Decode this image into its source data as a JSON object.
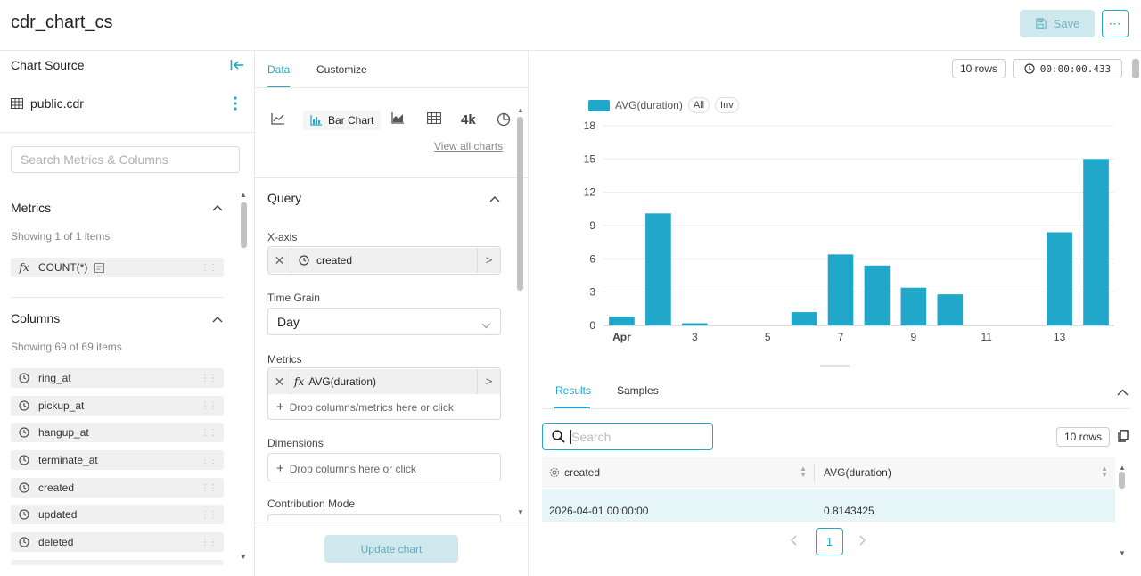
{
  "header": {
    "title": "cdr_chart_cs",
    "save_label": "Save",
    "more_label": "⋯"
  },
  "left_panel": {
    "title": "Chart Source",
    "dataset_name": "public.cdr",
    "search_placeholder": "Search Metrics & Columns",
    "metrics": {
      "title": "Metrics",
      "showing": "Showing 1 of 1 items",
      "items": [
        {
          "label": "COUNT(*)",
          "icon": "fx-icon"
        }
      ]
    },
    "columns": {
      "title": "Columns",
      "showing": "Showing 69 of 69 items",
      "items": [
        {
          "label": "ring_at",
          "icon": "clock-icon"
        },
        {
          "label": "pickup_at",
          "icon": "clock-icon"
        },
        {
          "label": "hangup_at",
          "icon": "clock-icon"
        },
        {
          "label": "terminate_at",
          "icon": "clock-icon"
        },
        {
          "label": "created",
          "icon": "clock-icon"
        },
        {
          "label": "updated",
          "icon": "clock-icon"
        },
        {
          "label": "deleted",
          "icon": "clock-icon"
        }
      ]
    }
  },
  "middle_panel": {
    "tabs": [
      {
        "label": "Data",
        "active": true
      },
      {
        "label": "Customize",
        "active": false
      }
    ],
    "viz_types": {
      "selected": "Bar Chart",
      "big_number_label": "4k",
      "view_all": "View all charts"
    },
    "query": {
      "title": "Query",
      "xaxis_label": "X-axis",
      "xaxis_value": "created",
      "time_grain_label": "Time Grain",
      "time_grain_value": "Day",
      "metrics_label": "Metrics",
      "metrics_value": "AVG(duration)",
      "metrics_drop": "Drop columns/metrics here or click",
      "dimensions_label": "Dimensions",
      "dimensions_drop": "Drop columns here or click",
      "contribution_label": "Contribution Mode"
    },
    "update_label": "Update chart"
  },
  "right_panel": {
    "rows_chip": "10 rows",
    "timer": "00:00:00.433",
    "legend": {
      "series": "AVG(duration)",
      "all": "All",
      "inv": "Inv"
    },
    "results_tabs": [
      {
        "label": "Results",
        "active": true
      },
      {
        "label": "Samples",
        "active": false
      }
    ],
    "search_placeholder": "Search",
    "table_rows_chip": "10 rows",
    "columns": [
      "created",
      "AVG(duration)"
    ],
    "rows": [
      [
        "2026-04-01 00:00:00",
        "0.8143425"
      ]
    ],
    "page": "1"
  },
  "colors": {
    "accent": "#20a7c9",
    "bar": "#20a7c9"
  },
  "chart_data": {
    "type": "bar",
    "x_tick_labels": [
      "Apr",
      "3",
      "5",
      "7",
      "9",
      "11",
      "13"
    ],
    "categories": [
      "Apr 1",
      "Apr 2",
      "Apr 3",
      "Apr 4",
      "Apr 5",
      "Apr 6",
      "Apr 7",
      "Apr 8",
      "Apr 9",
      "Apr 10",
      "Apr 11",
      "Apr 12",
      "Apr 13",
      "Apr 14"
    ],
    "values": [
      0.81,
      10.1,
      0.2,
      0,
      0,
      1.2,
      6.4,
      5.4,
      3.4,
      2.8,
      0,
      0,
      8.4,
      15.0
    ],
    "y_ticks": [
      0,
      3,
      6,
      9,
      12,
      15,
      18
    ],
    "ylim": [
      0,
      18
    ],
    "series_name": "AVG(duration)",
    "legend": "top-left",
    "grid": true
  }
}
